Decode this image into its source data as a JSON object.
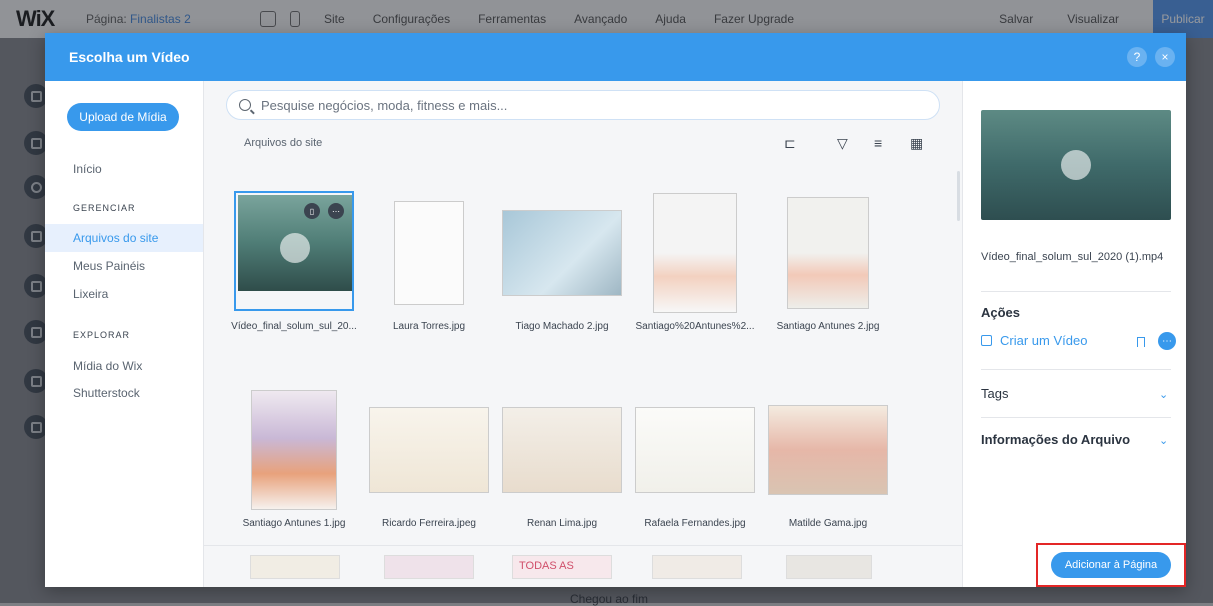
{
  "editor": {
    "logo": "WiX",
    "page_label": "Página:",
    "page_name": "Finalistas 2",
    "menu": [
      "Site",
      "Configurações",
      "Ferramentas",
      "Avançado",
      "Ajuda",
      "Fazer Upgrade"
    ],
    "save": "Salvar",
    "preview": "Visualizar",
    "publish": "Publicar",
    "bottom_text": "Chegou ao fim"
  },
  "modal": {
    "title": "Escolha um Vídeo",
    "help": "?",
    "close": "×"
  },
  "sidebar": {
    "upload": "Upload de Mídia",
    "home": "Início",
    "manage_heading": "GERENCIAR",
    "manage_items": [
      "Arquivos do site",
      "Meus Painéis",
      "Lixeira"
    ],
    "explore_heading": "EXPLORAR",
    "explore_items": [
      "Mídia do Wix",
      "Shutterstock"
    ]
  },
  "center": {
    "search_placeholder": "Pesquise negócios, moda, fitness e mais...",
    "crumb": "Arquivos do site",
    "files": [
      "Vídeo_final_solum_sul_20...",
      "Laura Torres.jpg",
      "Tiago Machado 2.jpg",
      "Santiago%20Antunes%2...",
      "Santiago Antunes 2.jpg",
      "Santiago Antunes 1.jpg",
      "Ricardo Ferreira.jpeg",
      "Renan Lima.jpg",
      "Rafaela Fernandes.jpg",
      "Matilde Gama.jpg"
    ],
    "partial_text": "TODAS AS"
  },
  "details": {
    "file_name": "Vídeo_final_solum_sul_2020 (1).mp4",
    "actions": "Ações",
    "create_video": "Criar um Vídeo",
    "tags": "Tags",
    "file_info": "Informações do Arquivo"
  },
  "add_button": "Adicionar à Página",
  "colors": {
    "accent": "#3899ec",
    "highlight": "#e32626"
  }
}
